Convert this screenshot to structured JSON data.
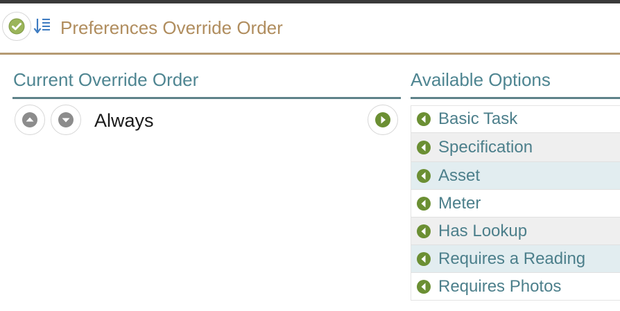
{
  "header": {
    "title": "Preferences Override Order",
    "confirm_icon": "check-circle-icon",
    "sort_icon": "sort-list-icon"
  },
  "current": {
    "title": "Current Override Order",
    "items": [
      {
        "label": "Always"
      }
    ]
  },
  "available": {
    "title": "Available Options",
    "items": [
      {
        "label": "Basic Task"
      },
      {
        "label": "Specification"
      },
      {
        "label": "Asset"
      },
      {
        "label": "Meter"
      },
      {
        "label": "Has Lookup"
      },
      {
        "label": "Requires a Reading"
      },
      {
        "label": "Requires Photos"
      }
    ]
  },
  "colors": {
    "header_title": "#b08d5e",
    "header_rule": "#b59a73",
    "section_title": "#4e8591",
    "section_rule": "#5e8289",
    "option_text": "#4c7f8b",
    "option_icon": "#6b8f33",
    "row_white": "#ffffff",
    "row_gray": "#efefef",
    "row_blue": "#e2edf0"
  }
}
